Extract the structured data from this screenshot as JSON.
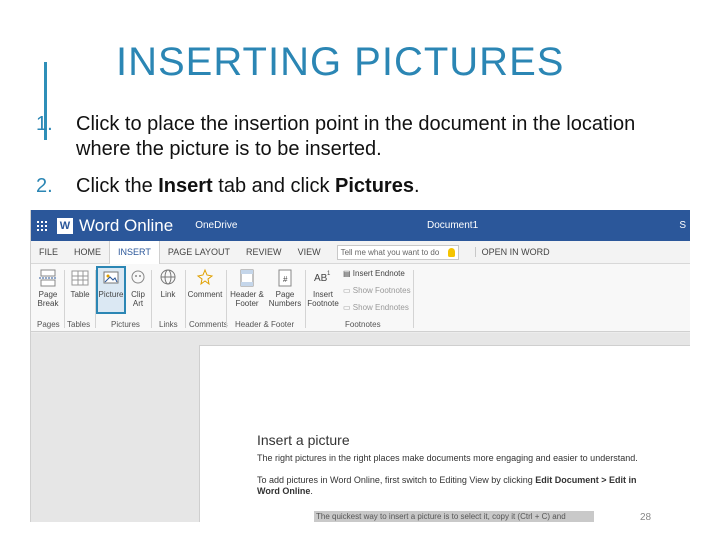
{
  "slide": {
    "title": "INSERTING PICTURES",
    "steps": [
      {
        "num": "1.",
        "text": "Click to place the insertion point in the document in the location where the picture is to be inserted."
      },
      {
        "num": "2.",
        "pre": "Click the ",
        "b1": "Insert",
        "mid": " tab and click ",
        "b2": "Pictures",
        "post": "."
      }
    ],
    "page_number": "28",
    "accent_color": "#2b86b4"
  },
  "word": {
    "app_name": "Word Online",
    "onedrive": "OneDrive",
    "document": "Document1",
    "user_initial": "S",
    "brand_color": "#2b579a",
    "tabs": [
      "FILE",
      "HOME",
      "INSERT",
      "PAGE LAYOUT",
      "REVIEW",
      "VIEW"
    ],
    "active_tab": "INSERT",
    "tell_me_placeholder": "Tell me what you want to do",
    "open_in_word": "OPEN IN WORD",
    "ribbon": {
      "page_break": "Page Break",
      "table": "Table",
      "picture": "Picture",
      "clip_art": "Clip Art",
      "link": "Link",
      "comment": "Comment",
      "header_footer": "Header & Footer",
      "page_numbers": "Page Numbers",
      "insert_footnote": "Insert Footnote",
      "insert_endnote": "Insert Endnote",
      "show_footnotes": "Show Footnotes",
      "show_endnotes": "Show Endnotes",
      "groups": [
        "Pages",
        "Tables",
        "Pictures",
        "Links",
        "Comments",
        "Header & Footer",
        "Footnotes"
      ]
    },
    "document_content": {
      "heading": "Insert a picture",
      "para1": "The right pictures in the right places make documents more engaging and easier to understand.",
      "para2_pre": "To add pictures in Word Online, first switch to Editing View by clicking ",
      "para2_b1": "Edit Document > Edit in Word Online",
      "para2_post": ".",
      "para3": "The quickest way to insert a picture is to select it, copy it (Ctrl + C) and"
    }
  }
}
